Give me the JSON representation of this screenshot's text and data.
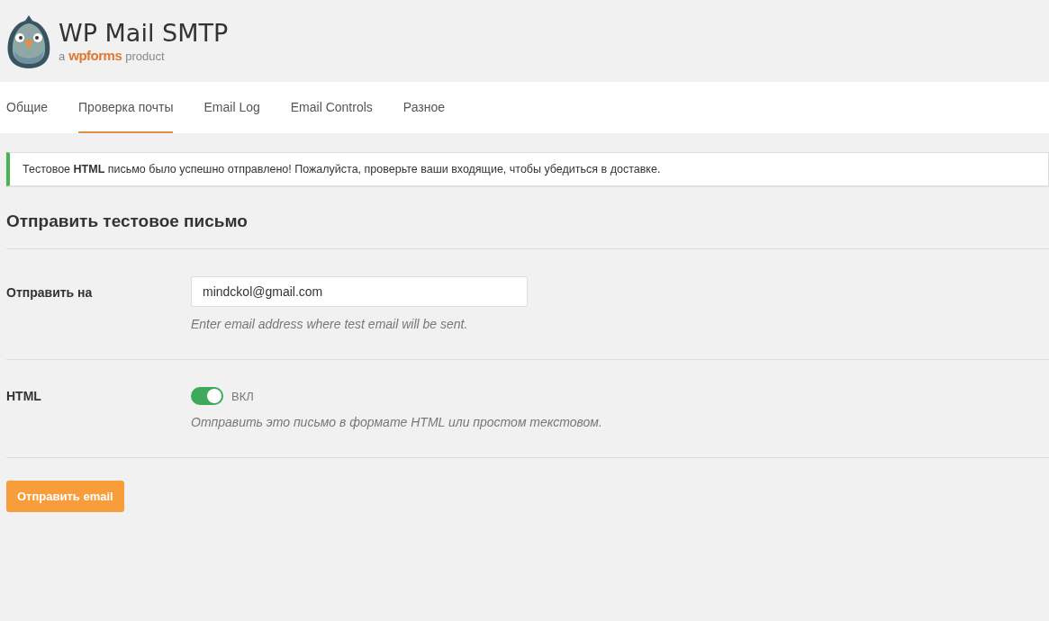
{
  "logo": {
    "title": "WP Mail SMTP",
    "prefix": "a",
    "brand": "wpforms",
    "suffix": "product"
  },
  "tabs": [
    {
      "label": "Общие",
      "selected": false
    },
    {
      "label": "Проверка почты",
      "selected": true
    },
    {
      "label": "Email Log",
      "selected": false
    },
    {
      "label": "Email Controls",
      "selected": false
    },
    {
      "label": "Разное",
      "selected": false
    }
  ],
  "notice": {
    "text": "Тестовое **HTML** письмо было успешно отправлено! Пожалуйста, проверьте ваши входящие, чтобы убедиться в доставке."
  },
  "heading": "Отправить тестовое письмо",
  "fields": [
    {
      "kind": "input",
      "label": "Отправить на",
      "value": "mindckol@gmail.com",
      "hint": "Enter email address where test email will be sent."
    },
    {
      "kind": "toggle",
      "label": "HTML",
      "on": true,
      "state_label": "ВКЛ",
      "hint": "Отправить это письмо в формате HTML или простом текстовом."
    }
  ],
  "submit": "Отправить email"
}
